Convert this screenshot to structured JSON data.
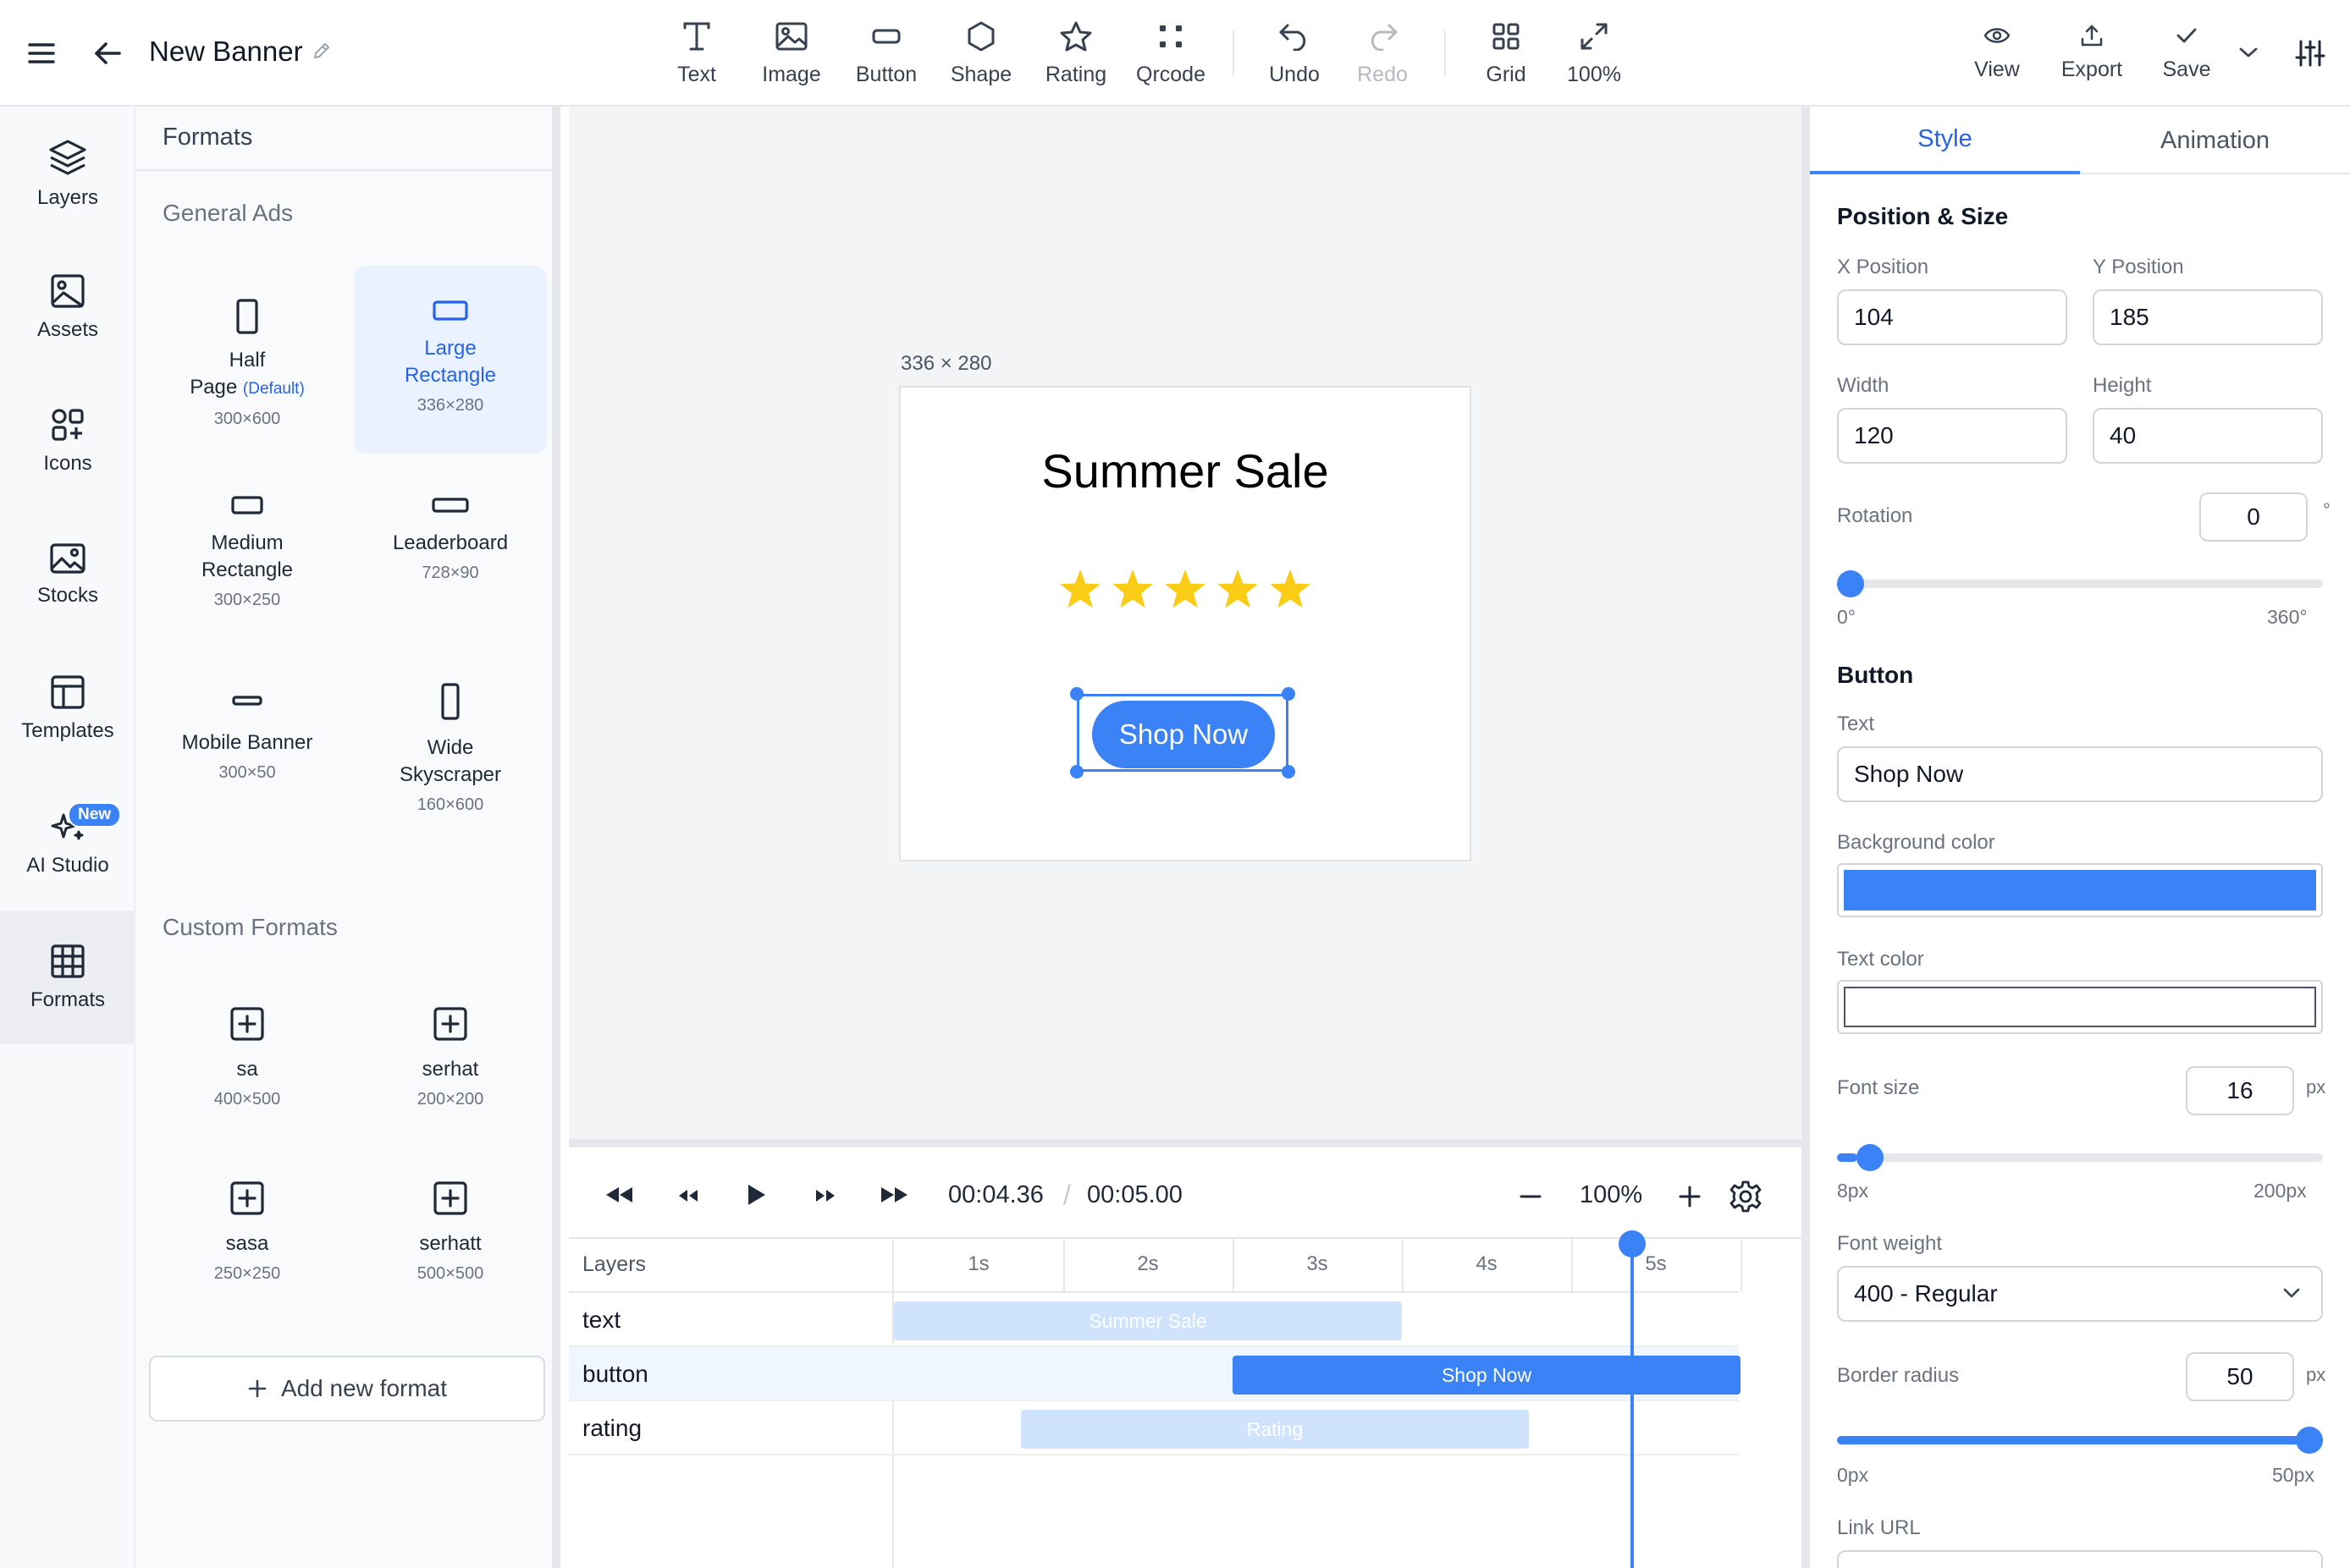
{
  "header": {
    "title": "New Banner"
  },
  "toolbar": {
    "tools": [
      "Text",
      "Image",
      "Button",
      "Shape",
      "Rating",
      "Qrcode"
    ],
    "undo": "Undo",
    "redo": "Redo",
    "grid": "Grid",
    "zoom": "100%",
    "view": "View",
    "export": "Export",
    "save": "Save"
  },
  "sidebar": {
    "items": [
      {
        "label": "Layers",
        "icon": "layers-icon"
      },
      {
        "label": "Assets",
        "icon": "image-icon"
      },
      {
        "label": "Icons",
        "icon": "shapes-icon"
      },
      {
        "label": "Stocks",
        "icon": "photo-icon"
      },
      {
        "label": "Templates",
        "icon": "template-icon"
      },
      {
        "label": "AI Studio",
        "icon": "sparkles-icon",
        "badge": "New"
      },
      {
        "label": "Formats",
        "icon": "grid-icon",
        "active": true
      }
    ]
  },
  "formats": {
    "title": "Formats",
    "general_title": "General Ads",
    "default_tag": "(Default)",
    "general": [
      {
        "name": "Half Page",
        "size": "300×600"
      },
      {
        "name": "Large Rectangle",
        "size": "336×280",
        "selected": true
      },
      {
        "name": "Medium Rectangle",
        "size": "300×250"
      },
      {
        "name": "Leaderboard",
        "size": "728×90"
      },
      {
        "name": "Mobile Banner",
        "size": "300×50"
      },
      {
        "name": "Wide Skyscraper",
        "size": "160×600"
      }
    ],
    "custom_title": "Custom Formats",
    "custom": [
      {
        "name": "sa",
        "size": "400×500"
      },
      {
        "name": "serhat",
        "size": "200×200"
      },
      {
        "name": "sasa",
        "size": "250×250"
      },
      {
        "name": "serhatt",
        "size": "500×500"
      }
    ],
    "add_label": "Add new format"
  },
  "canvas": {
    "size_label": "336 × 280",
    "headline": "Summer Sale",
    "rating": 5,
    "cta": "Shop Now",
    "accent": "#3b82f6"
  },
  "timeline": {
    "current_time": "00:04.36",
    "separator": "/",
    "total_time": "00:05.00",
    "zoom": "100%",
    "layers_header": "Layers",
    "ticks": [
      "1s",
      "2s",
      "3s",
      "4s",
      "5s"
    ],
    "playhead_seconds": 4.36,
    "tracks": [
      {
        "name": "text",
        "label": "Summer Sale",
        "start": 0.0,
        "end": 3.0,
        "active": false
      },
      {
        "name": "button",
        "label": "Shop Now",
        "start": 2.0,
        "end": 5.0,
        "active": true
      },
      {
        "name": "rating",
        "label": "Rating",
        "start": 0.75,
        "end": 3.75,
        "active": false
      }
    ]
  },
  "properties": {
    "tabs": [
      "Style",
      "Animation"
    ],
    "active_tab": "Style",
    "position_title": "Position & Size",
    "x_label": "X Position",
    "x": "104",
    "y_label": "Y Position",
    "y": "185",
    "w_label": "Width",
    "w": "120",
    "h_label": "Height",
    "h": "40",
    "rotation_label": "Rotation",
    "rotation": "0",
    "deg": "°",
    "rotation_min": "0°",
    "rotation_max": "360°",
    "rotation_value": 0,
    "button_title": "Button",
    "text_label": "Text",
    "text": "Shop Now",
    "bg_label": "Background color",
    "bg": "#3b82f6",
    "tc_label": "Text color",
    "tc": "#ffffff",
    "fs_label": "Font size",
    "fs": "16",
    "px": "px",
    "fs_min": "8px",
    "fs_max": "200px",
    "fs_value": 16,
    "fw_label": "Font weight",
    "fw": "400 - Regular",
    "br_label": "Border radius",
    "br": "50",
    "br_min": "0px",
    "br_max": "50px",
    "br_value": 50,
    "link_label": "Link URL"
  }
}
